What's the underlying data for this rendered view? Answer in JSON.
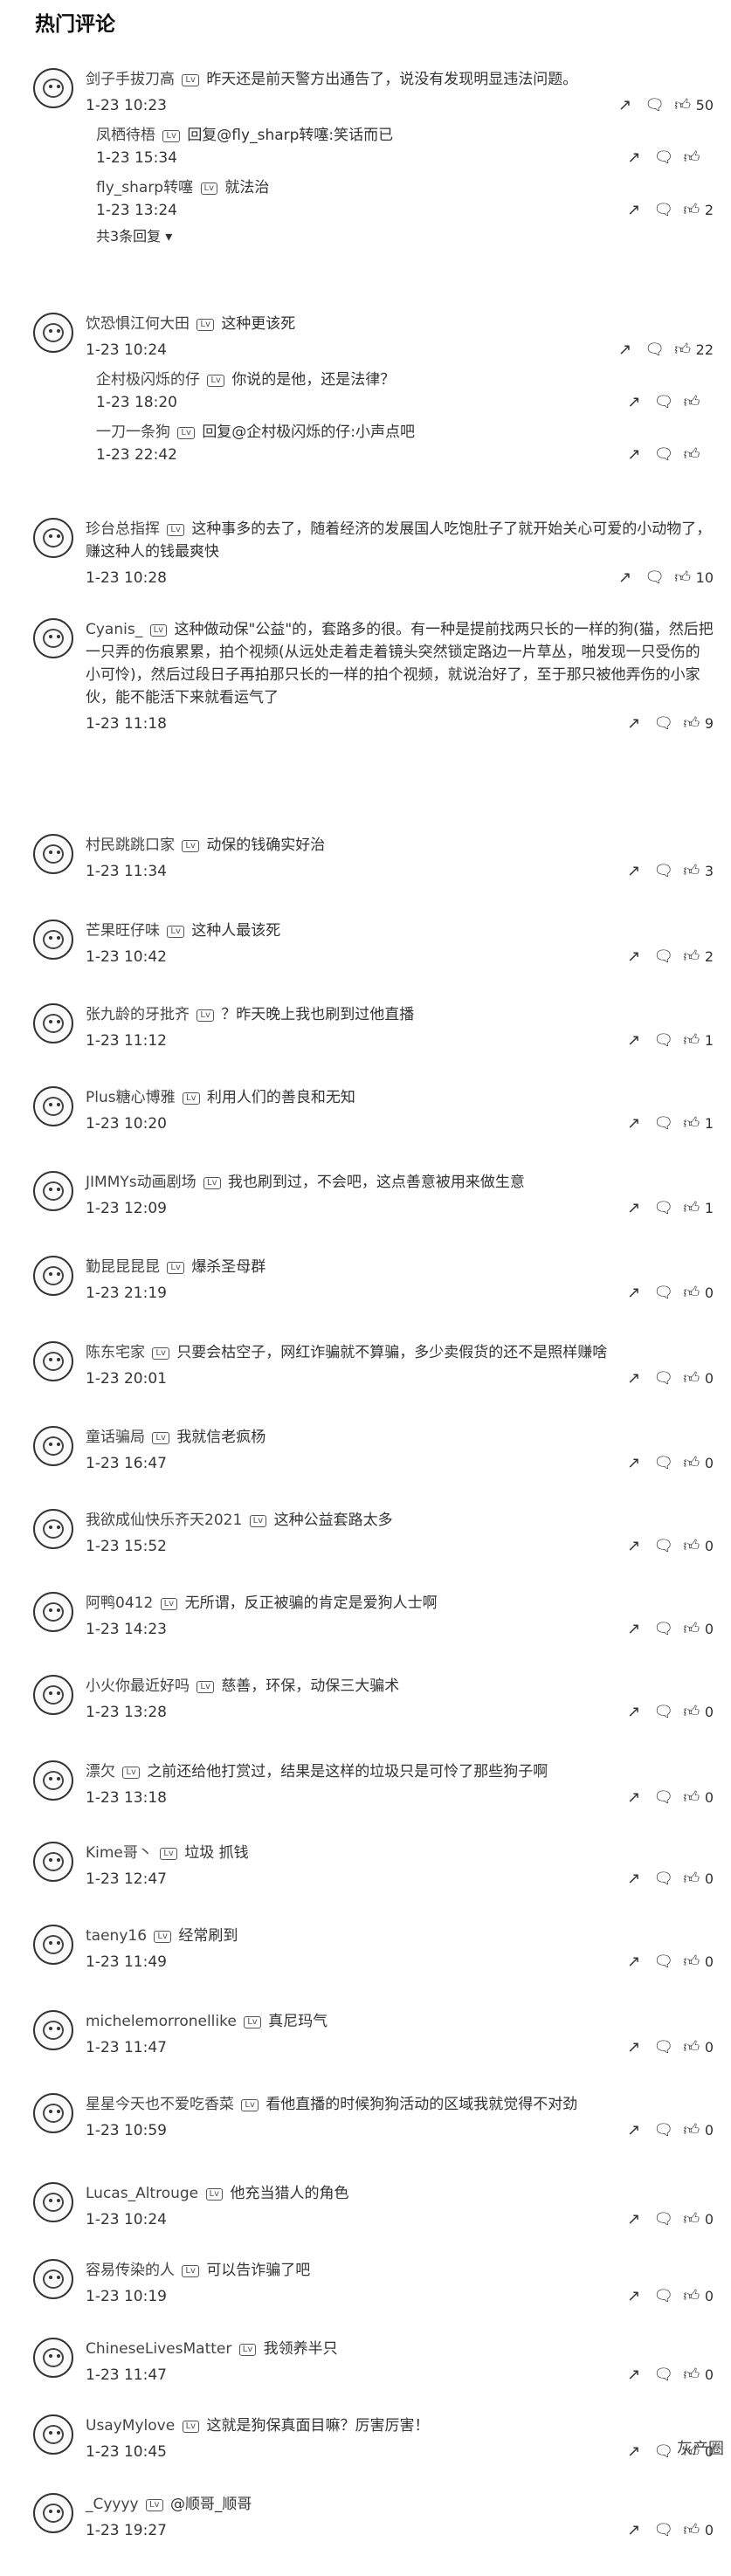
{
  "header": {
    "title": "热门评论"
  },
  "level_tag": "Lv",
  "watermark": "灰产圈",
  "comments": [
    {
      "user": "剑子手拔刀高",
      "text": "昨天还是前天警方出通告了，说没有发现明显违法问题。",
      "time": "1-23 10:23",
      "likes": "50",
      "replies": [
        {
          "user": "凤栖待梧",
          "text": "回复@fly_sharp转噻:笑话而已",
          "time": "1-23 15:34",
          "likes": ""
        },
        {
          "user": "fly_sharp转噻",
          "text": "就法治",
          "time": "1-23 13:24",
          "likes": "2"
        }
      ],
      "more": "共3条回复"
    },
    {
      "user": "饮恐惧江何大田",
      "text": "这种更该死",
      "time": "1-23 10:24",
      "likes": "22",
      "replies": [
        {
          "user": "企村极闪烁的仔",
          "text": "你说的是他，还是法律？",
          "time": "1-23 18:20",
          "likes": ""
        },
        {
          "user": "一刀一条狗",
          "text": "回复@企村极闪烁的仔:小声点吧",
          "time": "1-23 22:42",
          "likes": ""
        }
      ]
    },
    {
      "user": "珍台总指挥",
      "text": "这种事多的去了，随着经济的发展国人吃饱肚子了就开始关心可爱的小动物了，赚这种人的钱最爽快",
      "time": "1-23 10:28",
      "likes": "10",
      "replies": []
    },
    {
      "user": "Cyanis_",
      "text": "这种做动保\"公益\"的，套路多的很。有一种是提前找两只长的一样的狗(猫，然后把一只弄的伤痕累累，拍个视频(从远处走着走着镜头突然锁定路边一片草丛，啪发现一只受伤的小可怜)，然后过段日子再拍那只长的一样的拍个视频，就说治好了，至于那只被他弄伤的小家伙，能不能活下来就看运气了",
      "time": "1-23 11:18",
      "likes": "9",
      "replies": []
    },
    {
      "user": "村民跳跳口家",
      "text": "动保的钱确实好治",
      "time": "1-23 11:34",
      "likes": "3",
      "replies": []
    },
    {
      "user": "芒果旺仔味",
      "text": "这种人最该死",
      "time": "1-23 10:42",
      "likes": "2",
      "replies": []
    },
    {
      "user": "张九龄的牙批齐",
      "text": "？昨天晚上我也刷到过他直播",
      "time": "1-23 11:12",
      "likes": "1",
      "replies": []
    },
    {
      "user": "Plus糖心博雅",
      "text": "利用人们的善良和无知",
      "time": "1-23 10:20",
      "likes": "1",
      "replies": []
    },
    {
      "user": "JIMMYs动画剧场",
      "text": "我也刷到过，不会吧，这点善意被用来做生意",
      "time": "1-23 12:09",
      "likes": "1",
      "replies": []
    },
    {
      "user": "勤昆昆昆昆",
      "text": "爆杀圣母群",
      "time": "1-23 21:19",
      "likes": "0",
      "replies": []
    },
    {
      "user": "陈东宅家",
      "text": "只要会枯空子，网红诈骗就不算骗，多少卖假货的还不是照样赚啥",
      "time": "1-23 20:01",
      "likes": "0",
      "replies": []
    },
    {
      "user": "童话骗局",
      "text": "我就信老疯杨",
      "time": "1-23 16:47",
      "likes": "0",
      "replies": []
    },
    {
      "user": "我欲成仙快乐齐天2021",
      "text": "这种公益套路太多",
      "time": "1-23 15:52",
      "likes": "0",
      "replies": []
    },
    {
      "user": "阿鸭0412",
      "text": "无所谓，反正被骗的肯定是爱狗人士啊",
      "time": "1-23 14:23",
      "likes": "0",
      "replies": []
    },
    {
      "user": "小火你最近好吗",
      "text": "慈善，环保，动保三大骗术",
      "time": "1-23 13:28",
      "likes": "0",
      "replies": []
    },
    {
      "user": "漂欠",
      "text": "之前还给他打赏过，结果是这样的垃圾只是可怜了那些狗子啊",
      "time": "1-23 13:18",
      "likes": "0",
      "replies": []
    },
    {
      "user": "Kime哥丶",
      "text": "垃圾 抓钱",
      "time": "1-23 12:47",
      "likes": "0",
      "replies": []
    },
    {
      "user": "taeny16",
      "text": "经常刷到",
      "time": "1-23 11:49",
      "likes": "0",
      "replies": []
    },
    {
      "user": "michelemorronellike",
      "text": "真尼玛气",
      "time": "1-23 11:47",
      "likes": "0",
      "replies": []
    },
    {
      "user": "星星今天也不爱吃香菜",
      "text": "看他直播的时候狗狗活动的区域我就觉得不对劲",
      "time": "1-23 10:59",
      "likes": "0",
      "replies": []
    },
    {
      "user": "Lucas_Altrouge",
      "text": "他充当猎人的角色",
      "time": "1-23 10:24",
      "likes": "0",
      "replies": []
    },
    {
      "user": "容易传染的人",
      "text": "可以告诈骗了吧",
      "time": "1-23 10:19",
      "likes": "0",
      "replies": []
    },
    {
      "user": "ChineseLivesMatter",
      "text": "我领养半只",
      "time": "1-23 11:47",
      "likes": "0",
      "replies": []
    },
    {
      "user": "UsayMylove",
      "text": "这就是狗保真面目嘛？厉害厉害！",
      "time": "1-23 10:45",
      "likes": "0",
      "replies": []
    },
    {
      "user": "_Cyyyy",
      "text": "@顺哥_顺哥",
      "time": "1-23 19:27",
      "likes": "0",
      "replies": []
    }
  ]
}
